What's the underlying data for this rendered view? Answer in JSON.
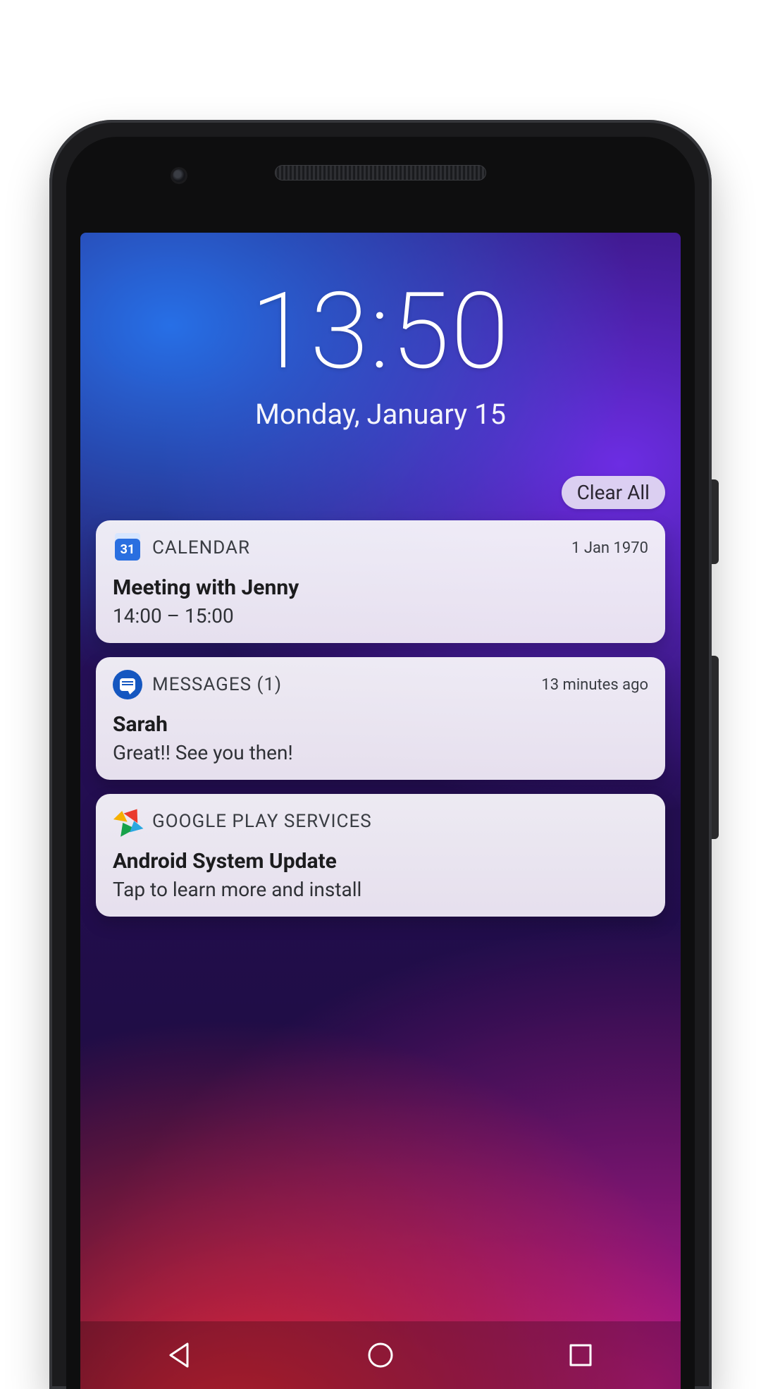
{
  "lock": {
    "time": "13:50",
    "date": "Monday, January 15"
  },
  "clear_all": "Clear All",
  "notifications": [
    {
      "app": "CALENDAR",
      "time": "1 Jan 1970",
      "title": "Meeting with Jenny",
      "subtitle": "14:00 – 15:00",
      "icon": "calendar-icon",
      "icon_day": "31"
    },
    {
      "app": "MESSAGES (1)",
      "time": "13 minutes ago",
      "title": "Sarah",
      "subtitle": "Great!! See you then!",
      "icon": "messages-icon"
    },
    {
      "app": "GOOGLE PLAY SERVICES",
      "time": "",
      "title": "Android System Update",
      "subtitle": "Tap to learn more and install",
      "icon": "play-services-icon"
    }
  ]
}
